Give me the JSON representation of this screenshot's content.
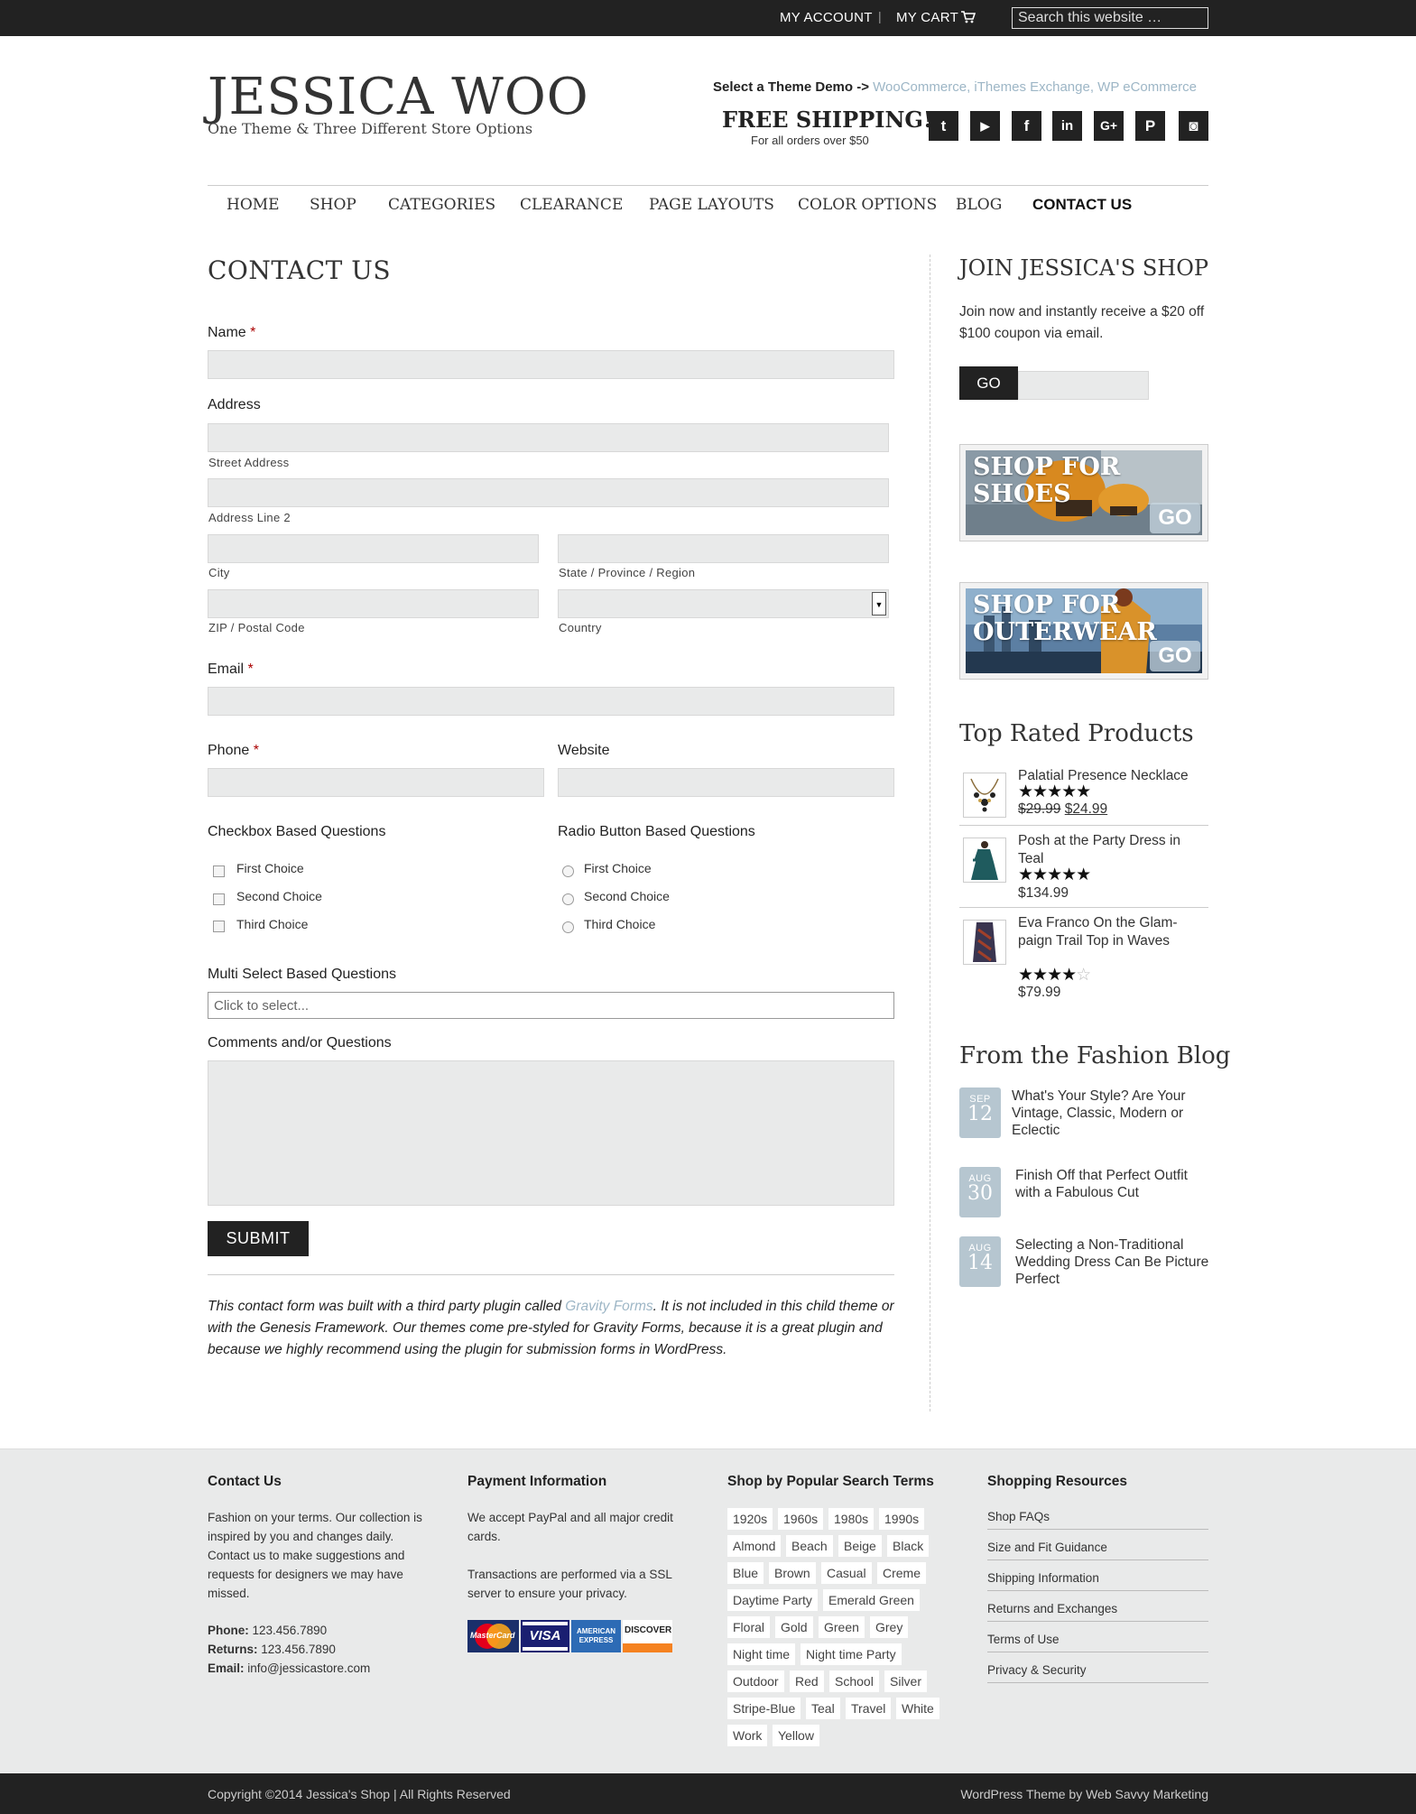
{
  "topbar": {
    "my_account": "MY ACCOUNT",
    "separator": "|",
    "my_cart": "MY CART",
    "search_placeholder": "Search this website …"
  },
  "header": {
    "logo": "JESSICA WOO",
    "tagline": "One Theme & Three Different Store Options",
    "demo_label": "Select a Theme Demo ->",
    "demo_links": [
      "WooCommerce",
      "iThemes Exchange",
      "WP eCommerce"
    ],
    "free_shipping": "FREE SHIPPING!",
    "free_shipping_sub": "For all orders over $50",
    "social": [
      {
        "icon": "twitter-icon",
        "glyph": "t"
      },
      {
        "icon": "youtube-icon",
        "glyph": "▶"
      },
      {
        "icon": "facebook-icon",
        "glyph": "f"
      },
      {
        "icon": "linkedin-icon",
        "glyph": "in"
      },
      {
        "icon": "google-plus-icon",
        "glyph": "G+"
      },
      {
        "icon": "pinterest-icon",
        "glyph": "P"
      },
      {
        "icon": "instagram-icon",
        "glyph": "◙"
      }
    ]
  },
  "nav": {
    "items": [
      "HOME",
      "SHOP",
      "CATEGORIES",
      "CLEARANCE",
      "PAGE LAYOUTS",
      "COLOR OPTIONS",
      "BLOG",
      "CONTACT US"
    ],
    "active": "CONTACT US"
  },
  "form": {
    "title": "CONTACT US",
    "name_label": "Name",
    "required_mark": "*",
    "address_label": "Address",
    "street_address": "Street Address",
    "address_line2": "Address Line 2",
    "city": "City",
    "state": "State / Province / Region",
    "zip": "ZIP / Postal Code",
    "country": "Country",
    "email_label": "Email",
    "phone_label": "Phone",
    "website_label": "Website",
    "checkbox_label": "Checkbox Based Questions",
    "checkbox_options": [
      "First Choice",
      "Second Choice",
      "Third Choice"
    ],
    "radio_label": "Radio Button Based Questions",
    "radio_options": [
      "First Choice",
      "Second Choice",
      "Third Choice"
    ],
    "multi_label": "Multi Select Based Questions",
    "multi_placeholder": "Click to select...",
    "comments_label": "Comments and/or Questions",
    "submit": "SUBMIT",
    "note_part1": "This contact form was built with a third party plugin called ",
    "note_link": "Gravity Forms",
    "note_part2": ".  It is not included in this child theme or with the Genesis Framework. Our themes come pre-styled for Gravity Forms, because it is a great plugin and because we highly recommend using the plugin for submission forms in WordPress."
  },
  "sidebar": {
    "join_title": "JOIN JESSICA'S SHOP",
    "join_text": "Join now and instantly receive a $20 off $100 coupon via email.",
    "go": "GO",
    "promo1": "SHOP FOR SHOES",
    "promo2": "SHOP FOR OUTERWEAR",
    "promo_go": "GO",
    "top_rated_title": "Top Rated Products",
    "products": [
      {
        "name": "Palatial Presence Necklace",
        "rating": 5,
        "stars": "★★★★★",
        "old_price": "$29.99",
        "price": "$24.99"
      },
      {
        "name": "Posh at the Party Dress in Teal",
        "rating": 5,
        "stars": "★★★★★",
        "price": "$134.99"
      },
      {
        "name": "Eva Franco On the Glam-paign Trail Top in Waves",
        "rating": 4,
        "stars": "★★★★",
        "empty_star": "☆",
        "price": "$79.99"
      }
    ],
    "blog_title": "From the Fashion Blog",
    "posts": [
      {
        "month": "SEP",
        "day": "12",
        "title": "What's Your Style? Are Your Vintage, Classic, Modern or Eclectic"
      },
      {
        "month": "AUG",
        "day": "30",
        "title": "Finish Off that Perfect Outfit with a Fabulous Cut"
      },
      {
        "month": "AUG",
        "day": "14",
        "title": "Selecting a Non-Traditional Wedding Dress Can Be Picture Perfect"
      }
    ]
  },
  "footer": {
    "contact_title": "Contact Us",
    "contact_text": "Fashion on your terms. Our collection is inspired by you and changes daily. Contact us to make suggestions and requests for designers we may have missed.",
    "phone_label": "Phone:",
    "phone": "123.456.7890",
    "returns_label": "Returns:",
    "returns": "123.456.7890",
    "email_label": "Email:",
    "email": "info@jessicastore.com",
    "payment_title": "Payment Information",
    "payment_text1": "We accept PayPal and all major credit cards.",
    "payment_text2": "Transactions are performed via a SSL server to ensure your privacy.",
    "cards": [
      "MasterCard",
      "VISA",
      "AMERICAN EXPRESS",
      "DISCOVER"
    ],
    "tags_title": "Shop by Popular Search Terms",
    "tags": [
      [
        "1920s",
        "1960s",
        "1980s",
        "1990s"
      ],
      [
        "Almond",
        "Beach",
        "Beige",
        "Black"
      ],
      [
        "Blue",
        "Brown",
        "Casual",
        "Creme"
      ],
      [
        "Daytime Party",
        "Emerald Green"
      ],
      [
        "Floral",
        "Gold",
        "Green",
        "Grey"
      ],
      [
        "Night time",
        "Night time Party"
      ],
      [
        "Outdoor",
        "Red",
        "School",
        "Silver"
      ],
      [
        "Stripe-Blue",
        "Teal",
        "Travel",
        "White"
      ],
      [
        "Work",
        "Yellow"
      ]
    ],
    "resources_title": "Shopping Resources",
    "resources": [
      "Shop FAQs",
      "Size and Fit Guidance",
      "Shipping Information",
      "Returns and Exchanges",
      "Terms of Use",
      "Privacy & Security"
    ],
    "copyright": "Copyright ©2014 Jessica's Shop | All Rights Reserved",
    "credit": "WordPress Theme by Web Savvy Marketing"
  }
}
